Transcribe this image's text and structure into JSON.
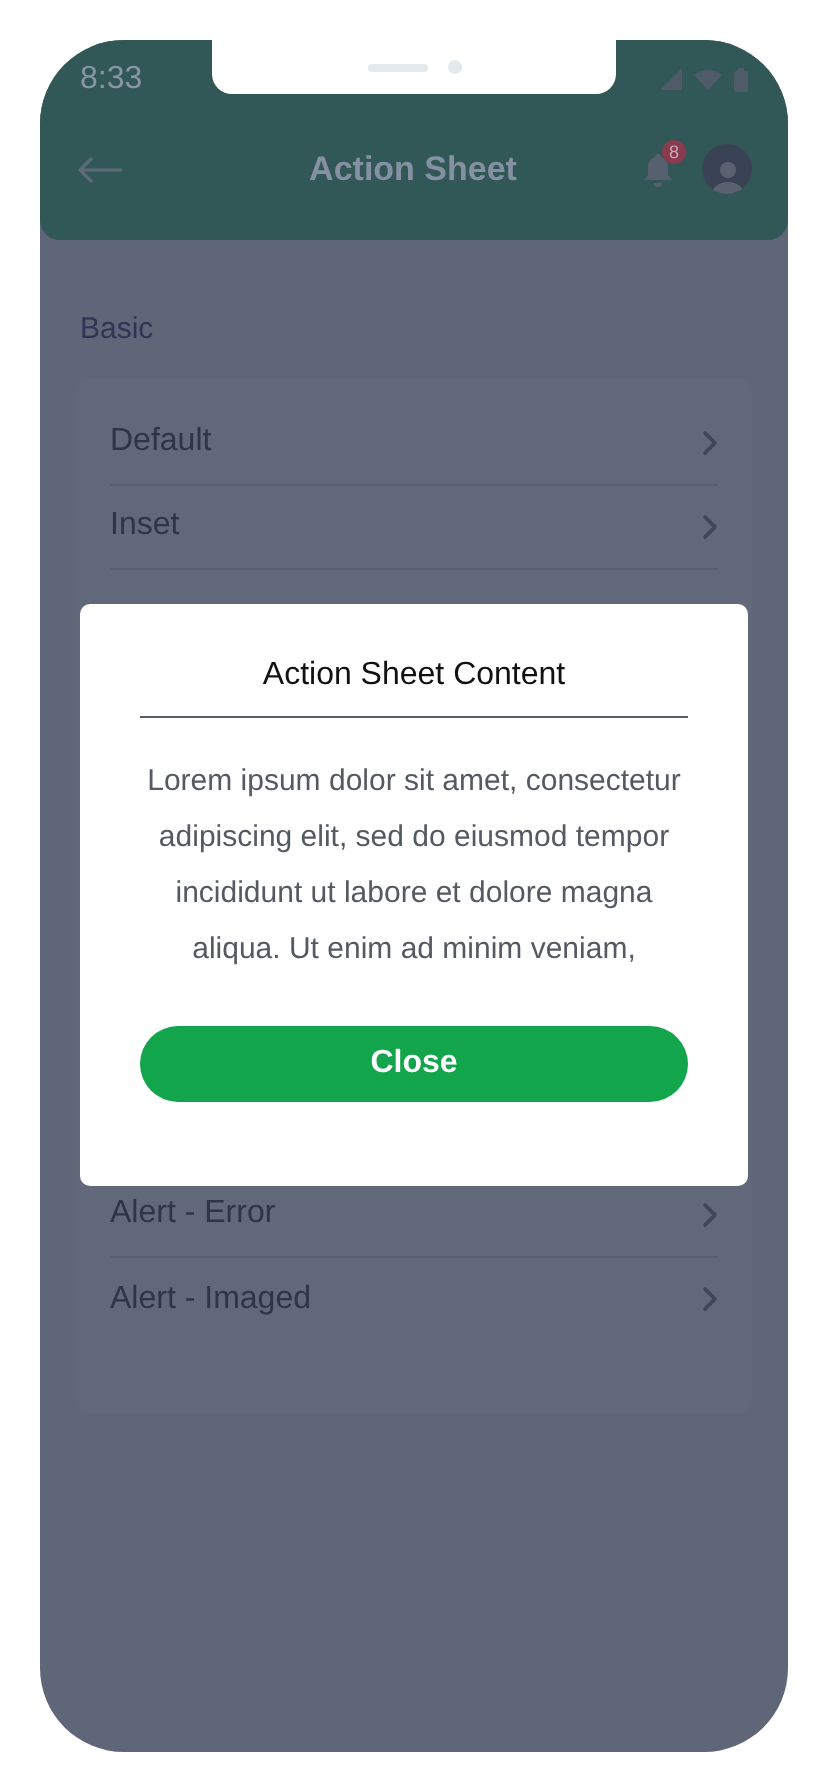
{
  "status_bar": {
    "time": "8:33"
  },
  "header": {
    "title": "Action Sheet",
    "notification_count": "8"
  },
  "section": {
    "title": "Basic",
    "items_above": [
      {
        "label": "Default"
      },
      {
        "label": "Inset"
      }
    ],
    "items_below": [
      {
        "label": "Alert - Error"
      },
      {
        "label": "Alert - Imaged"
      }
    ]
  },
  "action_sheet": {
    "title": "Action Sheet Content",
    "body": "Lorem ipsum dolor sit amet, consectetur adipiscing elit, sed do eiusmod tempor incididunt ut labore et dolore magna aliqua. Ut enim ad minim veniam,",
    "button": "Close"
  }
}
